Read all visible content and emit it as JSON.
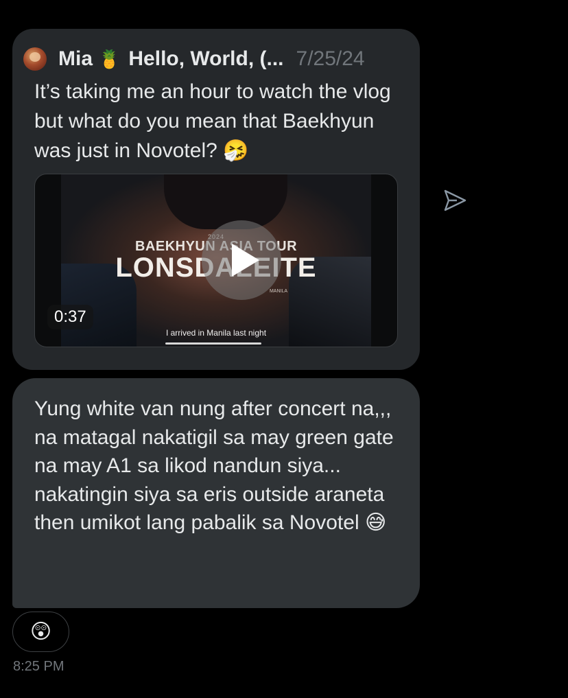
{
  "quoted_post": {
    "author_name": "Mia",
    "author_emoji": "🍍",
    "author_title": "Hello, World, (...",
    "date": "7/25/24",
    "text": "It’s taking me an hour to watch the vlog but what do you mean that Baekhyun was just in Novotel? 🤧",
    "video": {
      "duration": "0:37",
      "year": "2024",
      "overlay_line1": "BAEKHYUN ASIA TOUR",
      "overlay_title": "LONSDALEITE",
      "overlay_city": "MANILA",
      "subtitle": "I arrived in Manila last night"
    }
  },
  "message": {
    "text": "Yung white van nung after concert na,,, na matagal nakatigil sa may green gate na may A1 sa likod nandun siya... nakatingin siya sa eris outside araneta then umikot lang pabalik sa Novotel 😅"
  },
  "reaction": {
    "emoji": "😲"
  },
  "timestamp": "8:25 PM",
  "icons": {
    "share": "send-icon",
    "play": "play-icon",
    "avatar": "avatar"
  },
  "colors": {
    "background": "#000000",
    "bubble": "#2f3336",
    "quote_bubble": "#25282b",
    "primary_text": "#e7e9ea",
    "secondary_text": "#71767b"
  }
}
